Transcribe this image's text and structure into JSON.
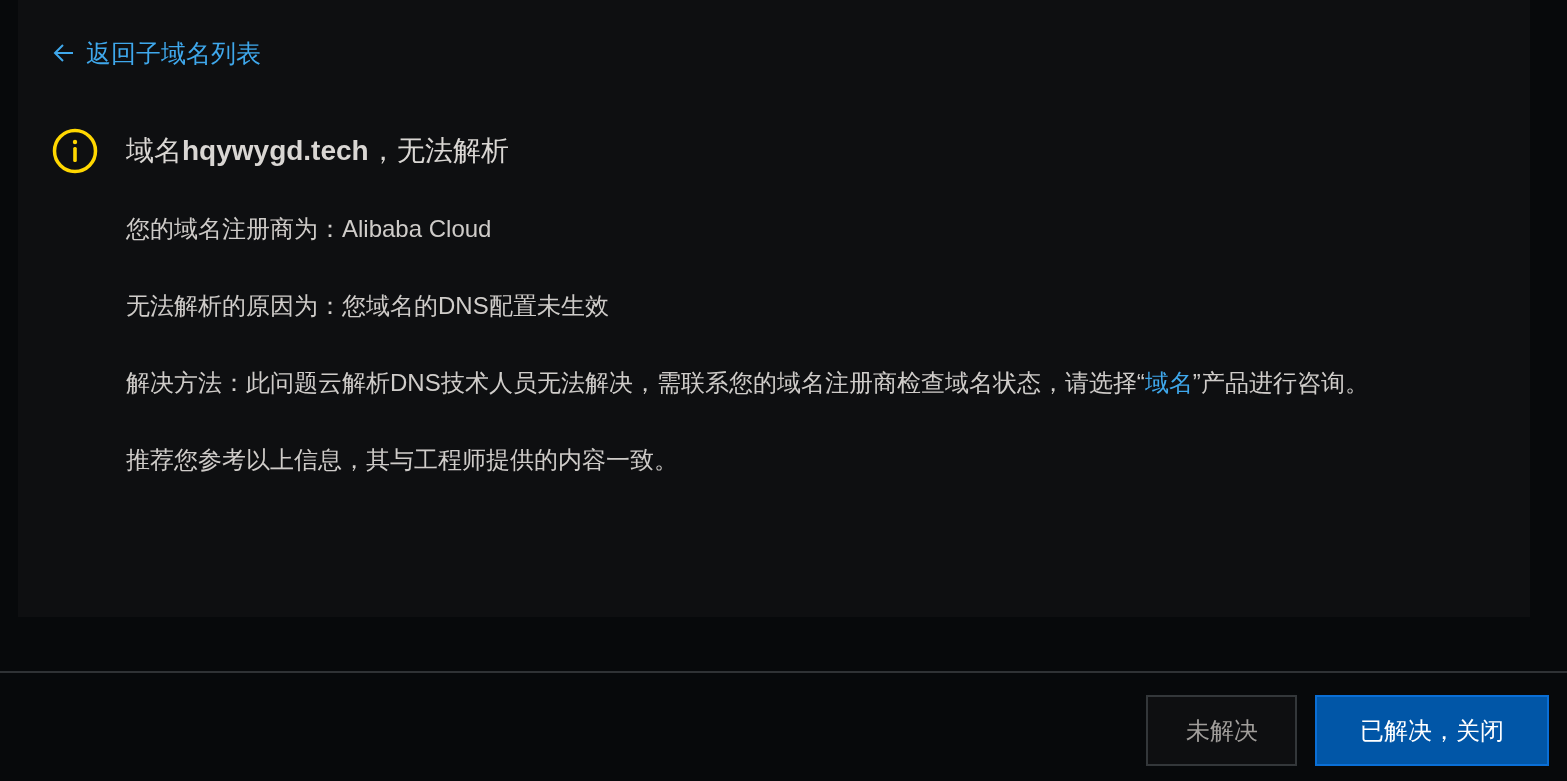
{
  "back_link": {
    "label": "返回子域名列表"
  },
  "alert": {
    "title": "域名**hqywygd.tech**，无法解析"
  },
  "details": [
    {
      "kind": "plain",
      "text": "您的域名注册商为：Alibaba Cloud"
    },
    {
      "kind": "plain",
      "text": "无法解析的原因为：您域名的DNS配置未生效"
    },
    {
      "kind": "solution",
      "label": "解决方法：",
      "before": "此问题云解析DNS技术人员无法解决，需联系您的域名注册商检查域名状态，请选择“",
      "link": "域名",
      "after": "”产品进行咨询。"
    },
    {
      "kind": "plain",
      "text": "推荐您参考以上信息，其与工程师提供的内容一致。"
    }
  ],
  "buttons": [
    {
      "label": "未解决",
      "kind": "default"
    },
    {
      "label": "已解决，关闭",
      "kind": "primary"
    }
  ]
}
